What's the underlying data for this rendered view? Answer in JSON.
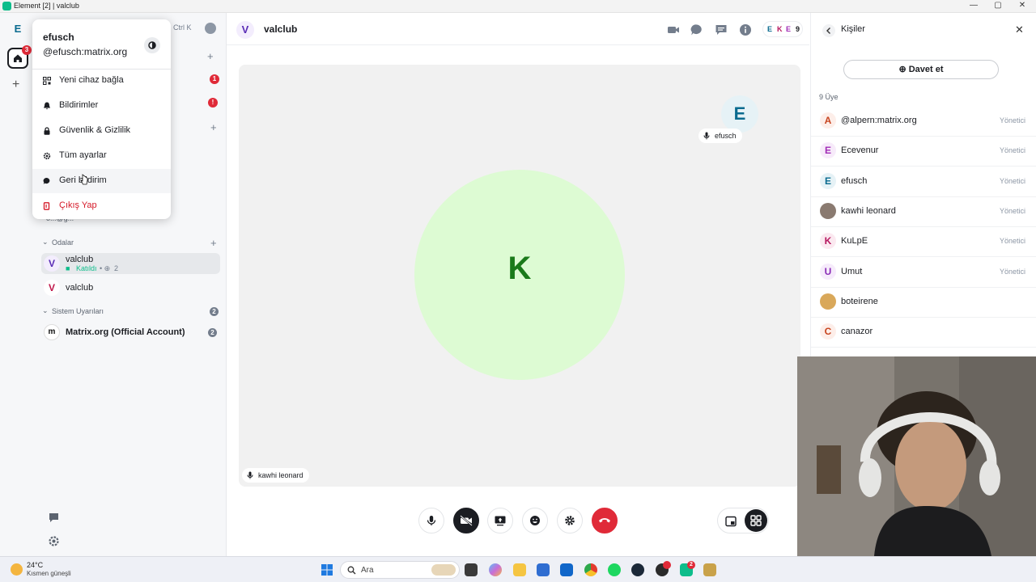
{
  "window": {
    "title": "Element [2] | valclub"
  },
  "space_bar": {
    "space_letter": "E",
    "home_badge": "3"
  },
  "search": {
    "shortcut": "Ctrl K"
  },
  "room_list": {
    "badge_1": "1",
    "badge_2": "!",
    "partial_item": "o...@g...",
    "rooms_section": "Odalar",
    "rooms": [
      {
        "letter": "V",
        "name": "valclub",
        "status": "Katıldı",
        "participants": "2"
      },
      {
        "letter": "V",
        "name": "valclub"
      }
    ],
    "system_section": "Sistem Uyarıları",
    "system_count": "2",
    "system_room": {
      "letter": "m",
      "name": "Matrix.org (Official Account)",
      "count": "2"
    }
  },
  "user_menu": {
    "display_name": "efusch",
    "user_id": "@efusch:matrix.org",
    "items": [
      {
        "label": "Yeni cihaz bağla",
        "icon": "qr-code-icon"
      },
      {
        "label": "Bildirimler",
        "icon": "bell-icon"
      },
      {
        "label": "Güvenlik & Gizlilik",
        "icon": "lock-icon"
      },
      {
        "label": "Tüm ayarlar",
        "icon": "gear-icon"
      },
      {
        "label": "Geri bildirim",
        "icon": "chat-icon"
      },
      {
        "label": "Çıkış Yap",
        "icon": "sign-out-icon"
      }
    ]
  },
  "header": {
    "room_letter": "V",
    "room_name": "valclub",
    "facepile": {
      "letters": [
        "E",
        "K",
        "E"
      ],
      "count": "9"
    }
  },
  "call": {
    "main_tile": {
      "letter": "K",
      "name": "kawhi leonard"
    },
    "self_tile": {
      "letter": "E",
      "name": "efusch"
    }
  },
  "right_panel": {
    "title": "Kişiler",
    "invite_label": "Davet et",
    "member_count": "9 Üye",
    "members": [
      {
        "letter": "A",
        "name": "@alpern:matrix.org",
        "role": "Yönetici",
        "color": "#c7441f",
        "bg": "#fdeee9"
      },
      {
        "letter": "E",
        "name": "Ecevenur",
        "role": "Yönetici",
        "color": "#a12cb6",
        "bg": "#f7ebfa"
      },
      {
        "letter": "E",
        "name": "efusch",
        "role": "Yönetici",
        "color": "#0a6b8f",
        "bg": "#e6f2f6"
      },
      {
        "letter": "",
        "name": "kawhi leonard",
        "role": "Yönetici",
        "color": "#333333",
        "bg": "#8a7a70"
      },
      {
        "letter": "K",
        "name": "KuLpE",
        "role": "Yönetici",
        "color": "#b6175f",
        "bg": "#fbe9f0"
      },
      {
        "letter": "U",
        "name": "Umut",
        "role": "Yönetici",
        "color": "#8a2cb6",
        "bg": "#f6ebfb"
      },
      {
        "letter": "",
        "name": "boteirene",
        "role": "",
        "color": "#333333",
        "bg": "#d9a85a"
      },
      {
        "letter": "C",
        "name": "canazor",
        "role": "",
        "color": "#c7441f",
        "bg": "#fdeee9"
      }
    ]
  },
  "taskbar": {
    "temperature": "24°C",
    "weather": "Kısmen güneşli",
    "search_label": "Ara",
    "element_badge": "2"
  }
}
